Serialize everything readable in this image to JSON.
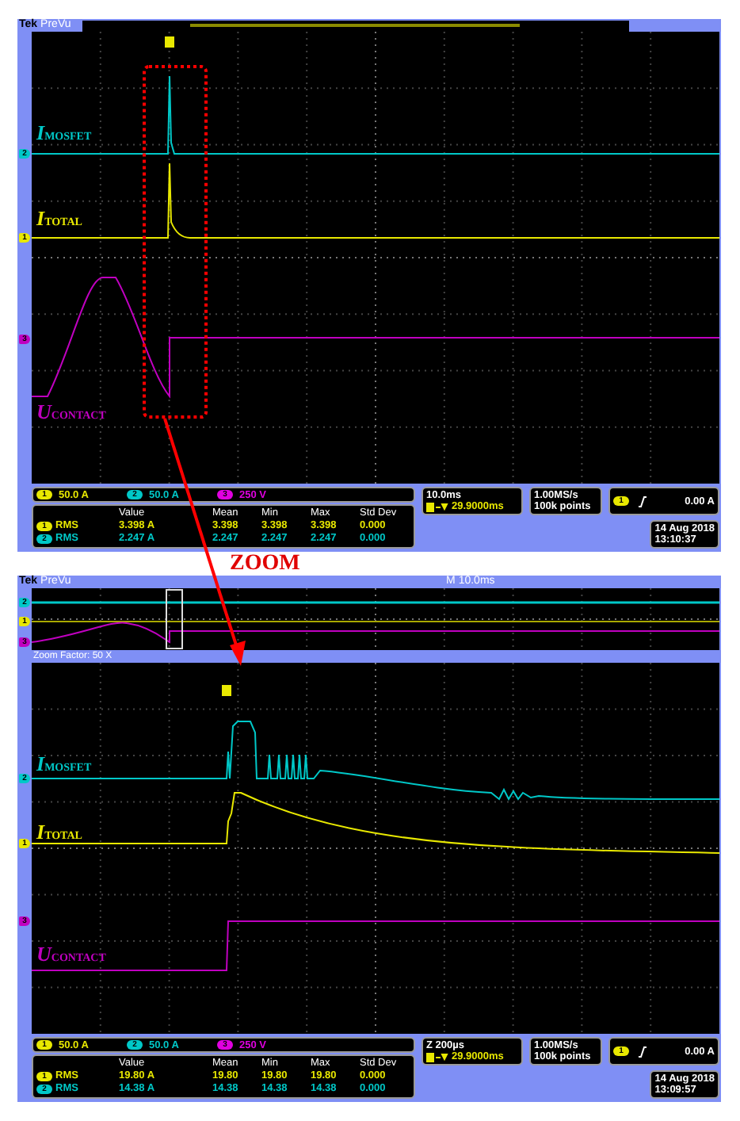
{
  "scopes": [
    {
      "kind": "acquisition",
      "brand": "Tek",
      "mode": "PreVu",
      "markers": [
        {
          "label": "2",
          "color": "#00c8c8"
        },
        {
          "label": "1",
          "color": "#e8e800"
        },
        {
          "label": "3",
          "color": "#c000c0"
        }
      ],
      "trace_labels": [
        {
          "text": "*I*$_{MOSFET}$",
          "color": "#00c8c8"
        },
        {
          "text": "*I*$_{TOTAL}$",
          "color": "#e8e800"
        },
        {
          "text": "*U*$_{CONTACT}$",
          "color": "#c000c0"
        }
      ],
      "readout": {
        "channels": [
          {
            "badge": "1",
            "scale": "50.0 A",
            "color": "#e8e800"
          },
          {
            "badge": "2",
            "scale": "50.0 A",
            "color": "#00c8c8"
          },
          {
            "badge": "3",
            "scale": "250 V",
            "color": "#e000e0"
          }
        ],
        "columns": [
          "Value",
          "Mean",
          "Min",
          "Max",
          "Std Dev"
        ],
        "rows": [
          {
            "badge": "1",
            "label": "RMS",
            "color": "#e8e800",
            "cells": [
              "3.398 A",
              "3.398",
              "3.398",
              "3.398",
              "0.000"
            ]
          },
          {
            "badge": "2",
            "label": "RMS",
            "color": "#00c8c8",
            "cells": [
              "2.247 A",
              "2.247",
              "2.247",
              "2.247",
              "0.000"
            ]
          }
        ],
        "timebase": "10.0ms",
        "position": "29.9000ms",
        "sample_rate": "1.00MS/s",
        "record_length": "100k points",
        "trigger_badge": "1",
        "trigger_level": "0.00 A",
        "date": "14 Aug 2018",
        "time": "13:10:37"
      }
    },
    {
      "kind": "zoom",
      "brand": "Tek",
      "mode": "PreVu",
      "main_timebase": "M 10.0ms",
      "zoom_factor": "Zoom Factor: 50 X",
      "overview_markers": [
        {
          "label": "2",
          "color": "#00c8c8"
        },
        {
          "label": "1",
          "color": "#e8e800"
        },
        {
          "label": "3",
          "color": "#c000c0"
        }
      ],
      "markers": [
        {
          "label": "2",
          "color": "#00c8c8"
        },
        {
          "label": "1",
          "color": "#e8e800"
        },
        {
          "label": "3",
          "color": "#c000c0"
        }
      ],
      "trace_labels": [
        {
          "text": "*I*$_{MOSFET}$",
          "color": "#00c8c8"
        },
        {
          "text": "*I*$_{TOTAL}$",
          "color": "#e8e800"
        },
        {
          "text": "*U*$_{CONTACT}$",
          "color": "#c000c0"
        }
      ],
      "readout": {
        "channels": [
          {
            "badge": "1",
            "scale": "50.0 A",
            "color": "#e8e800"
          },
          {
            "badge": "2",
            "scale": "50.0 A",
            "color": "#00c8c8"
          },
          {
            "badge": "3",
            "scale": "250 V",
            "color": "#e000e0"
          }
        ],
        "columns": [
          "Value",
          "Mean",
          "Min",
          "Max",
          "Std Dev"
        ],
        "rows": [
          {
            "badge": "1",
            "label": "RMS",
            "color": "#e8e800",
            "cells": [
              "19.80 A",
              "19.80",
              "19.80",
              "19.80",
              "0.000"
            ]
          },
          {
            "badge": "2",
            "label": "RMS",
            "color": "#00c8c8",
            "cells": [
              "14.38 A",
              "14.38",
              "14.38",
              "14.38",
              "0.000"
            ]
          }
        ],
        "timebase": "Z 200µs",
        "position": "29.9000ms",
        "sample_rate": "1.00MS/s",
        "record_length": "100k points",
        "trigger_badge": "1",
        "trigger_level": "0.00 A",
        "date": "14 Aug 2018",
        "time": "13:09:57"
      }
    }
  ],
  "annotation": {
    "label": "ZOOM"
  }
}
